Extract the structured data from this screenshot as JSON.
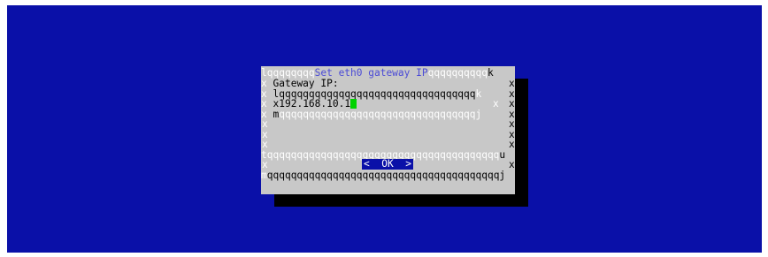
{
  "dialog": {
    "title": "Set eth0 gateway IP",
    "field_label": "Gateway IP:",
    "field_value": "192.168.10.1",
    "ok_label": "<  OK  >"
  }
}
